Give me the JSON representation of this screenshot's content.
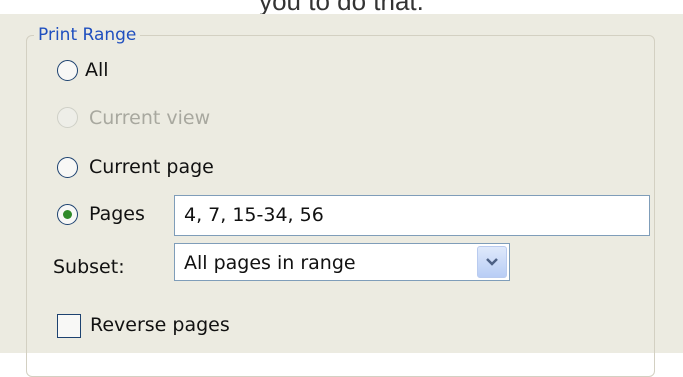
{
  "caption": "you to do that.",
  "group": {
    "title": "Print Range"
  },
  "options": {
    "all": "All",
    "current_view": "Current view",
    "current_page": "Current page",
    "pages": "Pages"
  },
  "pages_field": {
    "value": "4, 7, 15-34, 56"
  },
  "subset": {
    "label": "Subset:",
    "selected": "All pages in range"
  },
  "reverse": {
    "label": "Reverse pages"
  },
  "colors": {
    "legend": "#1f4fbf",
    "radio_dot": "#2f8a29",
    "panel_bg": "#ecebe1"
  }
}
